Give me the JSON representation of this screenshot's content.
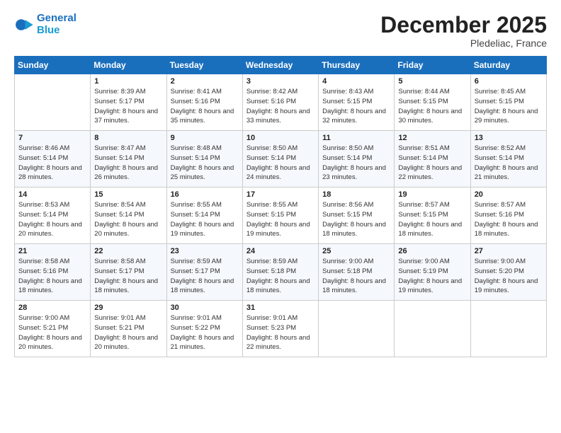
{
  "logo": {
    "line1": "General",
    "line2": "Blue"
  },
  "title": "December 2025",
  "subtitle": "Pledeliac, France",
  "headers": [
    "Sunday",
    "Monday",
    "Tuesday",
    "Wednesday",
    "Thursday",
    "Friday",
    "Saturday"
  ],
  "weeks": [
    [
      {
        "day": "",
        "sunrise": "",
        "sunset": "",
        "daylight": ""
      },
      {
        "day": "1",
        "sunrise": "Sunrise: 8:39 AM",
        "sunset": "Sunset: 5:17 PM",
        "daylight": "Daylight: 8 hours and 37 minutes."
      },
      {
        "day": "2",
        "sunrise": "Sunrise: 8:41 AM",
        "sunset": "Sunset: 5:16 PM",
        "daylight": "Daylight: 8 hours and 35 minutes."
      },
      {
        "day": "3",
        "sunrise": "Sunrise: 8:42 AM",
        "sunset": "Sunset: 5:16 PM",
        "daylight": "Daylight: 8 hours and 33 minutes."
      },
      {
        "day": "4",
        "sunrise": "Sunrise: 8:43 AM",
        "sunset": "Sunset: 5:15 PM",
        "daylight": "Daylight: 8 hours and 32 minutes."
      },
      {
        "day": "5",
        "sunrise": "Sunrise: 8:44 AM",
        "sunset": "Sunset: 5:15 PM",
        "daylight": "Daylight: 8 hours and 30 minutes."
      },
      {
        "day": "6",
        "sunrise": "Sunrise: 8:45 AM",
        "sunset": "Sunset: 5:15 PM",
        "daylight": "Daylight: 8 hours and 29 minutes."
      }
    ],
    [
      {
        "day": "7",
        "sunrise": "Sunrise: 8:46 AM",
        "sunset": "Sunset: 5:14 PM",
        "daylight": "Daylight: 8 hours and 28 minutes."
      },
      {
        "day": "8",
        "sunrise": "Sunrise: 8:47 AM",
        "sunset": "Sunset: 5:14 PM",
        "daylight": "Daylight: 8 hours and 26 minutes."
      },
      {
        "day": "9",
        "sunrise": "Sunrise: 8:48 AM",
        "sunset": "Sunset: 5:14 PM",
        "daylight": "Daylight: 8 hours and 25 minutes."
      },
      {
        "day": "10",
        "sunrise": "Sunrise: 8:50 AM",
        "sunset": "Sunset: 5:14 PM",
        "daylight": "Daylight: 8 hours and 24 minutes."
      },
      {
        "day": "11",
        "sunrise": "Sunrise: 8:50 AM",
        "sunset": "Sunset: 5:14 PM",
        "daylight": "Daylight: 8 hours and 23 minutes."
      },
      {
        "day": "12",
        "sunrise": "Sunrise: 8:51 AM",
        "sunset": "Sunset: 5:14 PM",
        "daylight": "Daylight: 8 hours and 22 minutes."
      },
      {
        "day": "13",
        "sunrise": "Sunrise: 8:52 AM",
        "sunset": "Sunset: 5:14 PM",
        "daylight": "Daylight: 8 hours and 21 minutes."
      }
    ],
    [
      {
        "day": "14",
        "sunrise": "Sunrise: 8:53 AM",
        "sunset": "Sunset: 5:14 PM",
        "daylight": "Daylight: 8 hours and 20 minutes."
      },
      {
        "day": "15",
        "sunrise": "Sunrise: 8:54 AM",
        "sunset": "Sunset: 5:14 PM",
        "daylight": "Daylight: 8 hours and 20 minutes."
      },
      {
        "day": "16",
        "sunrise": "Sunrise: 8:55 AM",
        "sunset": "Sunset: 5:14 PM",
        "daylight": "Daylight: 8 hours and 19 minutes."
      },
      {
        "day": "17",
        "sunrise": "Sunrise: 8:55 AM",
        "sunset": "Sunset: 5:15 PM",
        "daylight": "Daylight: 8 hours and 19 minutes."
      },
      {
        "day": "18",
        "sunrise": "Sunrise: 8:56 AM",
        "sunset": "Sunset: 5:15 PM",
        "daylight": "Daylight: 8 hours and 18 minutes."
      },
      {
        "day": "19",
        "sunrise": "Sunrise: 8:57 AM",
        "sunset": "Sunset: 5:15 PM",
        "daylight": "Daylight: 8 hours and 18 minutes."
      },
      {
        "day": "20",
        "sunrise": "Sunrise: 8:57 AM",
        "sunset": "Sunset: 5:16 PM",
        "daylight": "Daylight: 8 hours and 18 minutes."
      }
    ],
    [
      {
        "day": "21",
        "sunrise": "Sunrise: 8:58 AM",
        "sunset": "Sunset: 5:16 PM",
        "daylight": "Daylight: 8 hours and 18 minutes."
      },
      {
        "day": "22",
        "sunrise": "Sunrise: 8:58 AM",
        "sunset": "Sunset: 5:17 PM",
        "daylight": "Daylight: 8 hours and 18 minutes."
      },
      {
        "day": "23",
        "sunrise": "Sunrise: 8:59 AM",
        "sunset": "Sunset: 5:17 PM",
        "daylight": "Daylight: 8 hours and 18 minutes."
      },
      {
        "day": "24",
        "sunrise": "Sunrise: 8:59 AM",
        "sunset": "Sunset: 5:18 PM",
        "daylight": "Daylight: 8 hours and 18 minutes."
      },
      {
        "day": "25",
        "sunrise": "Sunrise: 9:00 AM",
        "sunset": "Sunset: 5:18 PM",
        "daylight": "Daylight: 8 hours and 18 minutes."
      },
      {
        "day": "26",
        "sunrise": "Sunrise: 9:00 AM",
        "sunset": "Sunset: 5:19 PM",
        "daylight": "Daylight: 8 hours and 19 minutes."
      },
      {
        "day": "27",
        "sunrise": "Sunrise: 9:00 AM",
        "sunset": "Sunset: 5:20 PM",
        "daylight": "Daylight: 8 hours and 19 minutes."
      }
    ],
    [
      {
        "day": "28",
        "sunrise": "Sunrise: 9:00 AM",
        "sunset": "Sunset: 5:21 PM",
        "daylight": "Daylight: 8 hours and 20 minutes."
      },
      {
        "day": "29",
        "sunrise": "Sunrise: 9:01 AM",
        "sunset": "Sunset: 5:21 PM",
        "daylight": "Daylight: 8 hours and 20 minutes."
      },
      {
        "day": "30",
        "sunrise": "Sunrise: 9:01 AM",
        "sunset": "Sunset: 5:22 PM",
        "daylight": "Daylight: 8 hours and 21 minutes."
      },
      {
        "day": "31",
        "sunrise": "Sunrise: 9:01 AM",
        "sunset": "Sunset: 5:23 PM",
        "daylight": "Daylight: 8 hours and 22 minutes."
      },
      {
        "day": "",
        "sunrise": "",
        "sunset": "",
        "daylight": ""
      },
      {
        "day": "",
        "sunrise": "",
        "sunset": "",
        "daylight": ""
      },
      {
        "day": "",
        "sunrise": "",
        "sunset": "",
        "daylight": ""
      }
    ]
  ]
}
